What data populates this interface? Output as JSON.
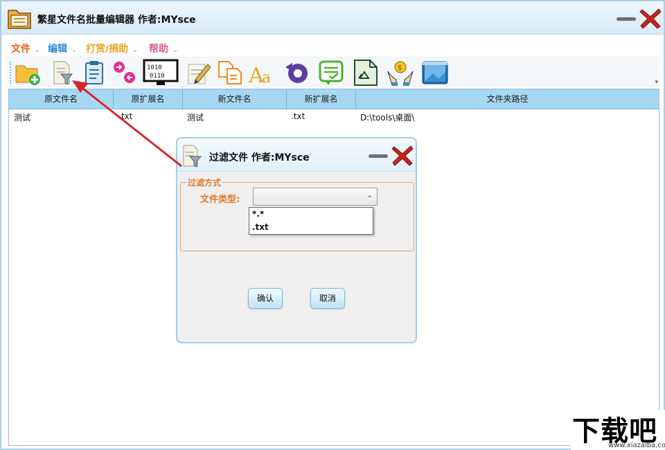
{
  "window": {
    "title": "繁星文件名批量编辑器  作者:MYsce"
  },
  "menu": [
    {
      "label": "文件",
      "color": "#e8620f"
    },
    {
      "label": "编辑",
      "color": "#2c8fd6"
    },
    {
      "label": "打赏/捐助",
      "color": "#f0a020"
    },
    {
      "label": "帮助",
      "color": "#e05a8e"
    }
  ],
  "menu_chevron": "⌄",
  "toolbar": {
    "tools": [
      "add-folder-icon",
      "filter-file-icon",
      "clipboard-icon",
      "swap-arrows-icon",
      "binary-monitor-icon",
      "edit-document-icon",
      "copy-document-icon",
      "font-aa-icon",
      "undo-icon",
      "checklist-icon",
      "recycle-document-icon",
      "donate-hands-icon",
      "window-app-icon"
    ]
  },
  "table": {
    "columns": [
      "原文件名",
      "原扩展名",
      "新文件名",
      "新扩展名",
      "文件夹路径"
    ],
    "rows": [
      [
        "测试",
        ".txt",
        "测试",
        ".txt",
        "D:\\tools\\桌面\\"
      ]
    ]
  },
  "dialog": {
    "title": "过滤文件  作者:MYsce",
    "group_label": "过滤方式",
    "field_label": "文件类型:",
    "select_value": "",
    "options": [
      "*.*",
      ".txt"
    ],
    "ok_label": "确认",
    "cancel_label": "取消"
  },
  "watermark": {
    "main": "下载吧",
    "sub": "www.xiazaiba.com"
  },
  "colors": {
    "accent": "#a7d8f3",
    "close_red": "#c8231c",
    "annotation_arrow": "#d9252a"
  }
}
